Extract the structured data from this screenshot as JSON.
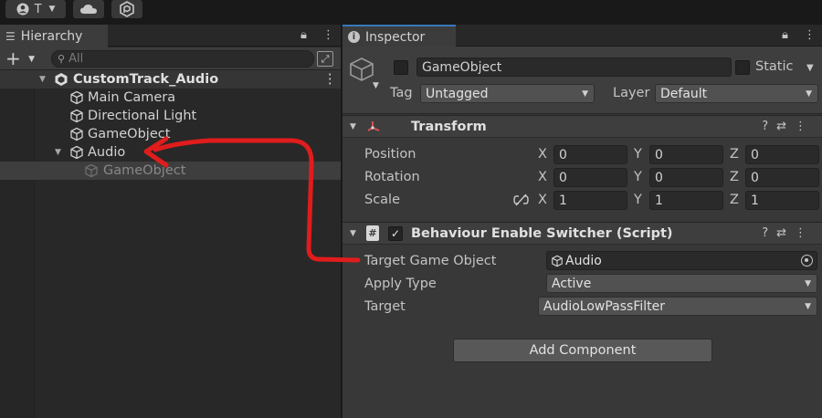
{
  "toolbar": {
    "account_label": "T",
    "account_icon": "account-icon",
    "cloud_icon": "cloud-icon",
    "collab_icon": "collab-icon"
  },
  "hierarchy": {
    "tab_label": "Hierarchy",
    "add_label": "+",
    "search_placeholder": "All",
    "scene_name": "CustomTrack_Audio",
    "items": [
      {
        "label": "Main Camera"
      },
      {
        "label": "Directional Light"
      },
      {
        "label": "GameObject"
      },
      {
        "label": "Audio"
      },
      {
        "label": "GameObject"
      }
    ]
  },
  "inspector": {
    "tab_label": "Inspector",
    "object_name": "GameObject",
    "static_label": "Static",
    "tag_label": "Tag",
    "tag_value": "Untagged",
    "layer_label": "Layer",
    "layer_value": "Default",
    "transform": {
      "title": "Transform",
      "position_label": "Position",
      "rotation_label": "Rotation",
      "scale_label": "Scale",
      "axis_x": "X",
      "axis_y": "Y",
      "axis_z": "Z",
      "position": {
        "x": "0",
        "y": "0",
        "z": "0"
      },
      "rotation": {
        "x": "0",
        "y": "0",
        "z": "0"
      },
      "scale": {
        "x": "1",
        "y": "1",
        "z": "1"
      }
    },
    "script": {
      "title": "Behaviour Enable Switcher (Script)",
      "target_go_label": "Target Game Object",
      "target_go_value": "Audio",
      "apply_type_label": "Apply Type",
      "apply_type_value": "Active",
      "target_label": "Target",
      "target_value": "AudioLowPassFilter"
    },
    "add_component_label": "Add Component"
  },
  "colors": {
    "accent_tab": "#3a79bb",
    "annotation_arrow": "#e01c1c"
  }
}
